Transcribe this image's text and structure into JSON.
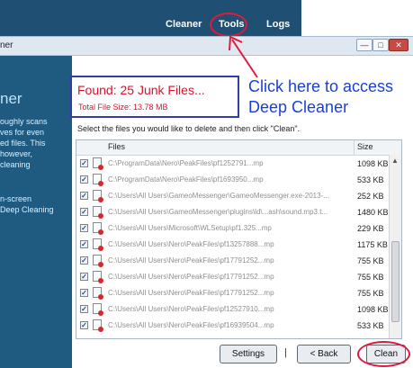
{
  "top_nav": {
    "cleaner": "Cleaner",
    "tools": "Tools",
    "logs": "Logs"
  },
  "window": {
    "title_fragment": "ner",
    "min": "—",
    "max": "□",
    "close": "✕"
  },
  "left_panel": {
    "title_fragment": "ner",
    "desc": "oughly scans\nves for even\ned files.  This\nhowever,\ncleaning",
    "desc2": "n-screen\nDeep Cleaning"
  },
  "found_box": {
    "title": "Found: 25 Junk Files...",
    "total_size": "Total File Size: 13.78 MB"
  },
  "annotation": {
    "text": "Click here to access\nDeep Cleaner"
  },
  "instruction": "Select the files you would like to delete and then click \"Clean\".",
  "table": {
    "headers": {
      "files": "Files",
      "size": "Size"
    },
    "rows": [
      {
        "path": "C:\\ProgramData\\Nero\\PeakFiles\\pf1252791...mp",
        "size": "1098 KB"
      },
      {
        "path": "C:\\ProgramData\\Nero\\PeakFiles\\pf1693950...mp",
        "size": "533 KB"
      },
      {
        "path": "C:\\Users\\All Users\\GameoMessenger\\GameoMessenger.exe-2013-...",
        "size": "252 KB"
      },
      {
        "path": "C:\\Users\\All Users\\GameoMessenger\\plugins\\ld\\...ash\\sound.mp3.t...",
        "size": "1480 KB"
      },
      {
        "path": "C:\\Users\\All Users\\Microsoft\\WLSetup\\pf1.325...mp",
        "size": "229 KB"
      },
      {
        "path": "C:\\Users\\All Users\\Nero\\PeakFiles\\pf13257888...mp",
        "size": "1175 KB"
      },
      {
        "path": "C:\\Users\\All Users\\Nero\\PeakFiles\\pf17791252...mp",
        "size": "755 KB"
      },
      {
        "path": "C:\\Users\\All Users\\Nero\\PeakFiles\\pf17791252...mp",
        "size": "755 KB"
      },
      {
        "path": "C:\\Users\\All Users\\Nero\\PeakFiles\\pf17791252...mp",
        "size": "755 KB"
      },
      {
        "path": "C:\\Users\\All Users\\Nero\\PeakFiles\\pf12527910...mp",
        "size": "1098 KB"
      },
      {
        "path": "C:\\Users\\All Users\\Nero\\PeakFiles\\pf16939504...mp",
        "size": "533 KB"
      }
    ],
    "checked_mark": "✓"
  },
  "buttons": {
    "settings": "Settings",
    "separator": "|",
    "back": "< Back",
    "clean": "Clean"
  },
  "colors": {
    "brand_dark": "#1f5a80",
    "highlight": "#e01a3c",
    "annotation": "#1a3fd8",
    "found_text": "#d4162f"
  }
}
